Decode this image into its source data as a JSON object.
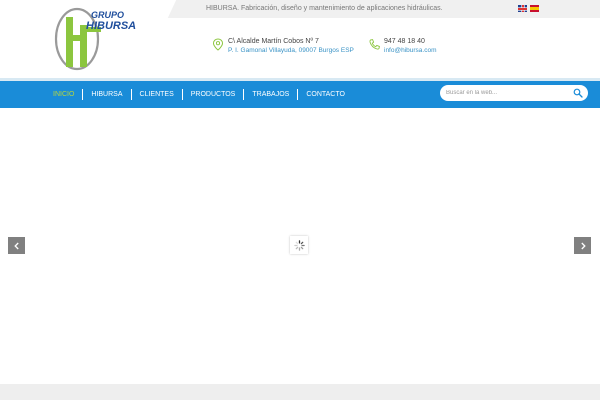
{
  "header": {
    "tagline": "HIBURSA. Fabricación, diseño y mantenimiento de aplicaciones hidráulicas.",
    "logo": {
      "word1": "GRUPO",
      "word2": "HIBURSA",
      "icon": "hibursa-logo"
    },
    "languages": [
      {
        "name": "English",
        "icon": "uk-flag-icon"
      },
      {
        "name": "Español",
        "icon": "spain-flag-icon"
      }
    ],
    "address": {
      "line1": "C\\ Alcalde Martín Cobos Nº 7",
      "line2": "P. I. Gamonal Villayuda, 09007 Burgos ESP",
      "icon": "location-pin-icon"
    },
    "phone": {
      "line1": "947 48 18 40",
      "line2": "info@hibursa.com",
      "icon": "phone-icon"
    }
  },
  "nav": {
    "items": [
      {
        "label": "INICIO",
        "active": true
      },
      {
        "label": "HIBURSA",
        "active": false
      },
      {
        "label": "CLIENTES",
        "active": false
      },
      {
        "label": "PRODUCTOS",
        "active": false
      },
      {
        "label": "TRABAJOS",
        "active": false
      },
      {
        "label": "CONTACTO",
        "active": false
      }
    ],
    "search": {
      "placeholder": "Buscar en la web...",
      "icon": "search-icon"
    }
  },
  "slider": {
    "prev_icon": "chevron-left-icon",
    "next_icon": "chevron-right-icon",
    "loader_icon": "loading-spinner-icon"
  },
  "colors": {
    "nav_blue": "#1a8cd8",
    "active_green": "#b8d73b",
    "link_blue": "#3a93c6",
    "logo_green": "#8cc63f",
    "logo_blue": "#1f4e9c"
  }
}
